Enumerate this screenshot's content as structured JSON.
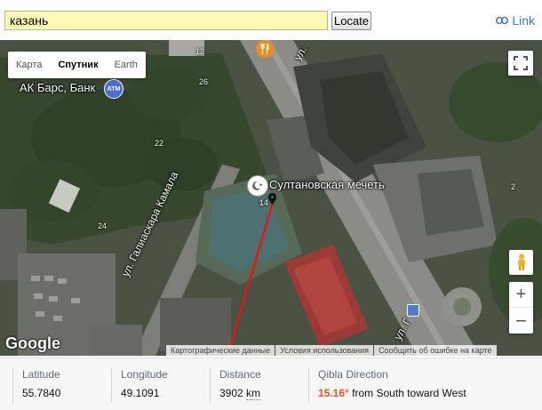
{
  "toolbar": {
    "search_value": "казань",
    "locate_label": "Locate",
    "link_label": "Link"
  },
  "map": {
    "map_type_buttons": [
      "Карта",
      "Спутник",
      "Earth"
    ],
    "active_map_type": "Спутник",
    "labels": {
      "poi_bank": "АК Барс, Банк",
      "poi_mosque": "Султановская мечеть",
      "street_galiaskara": "ул. Галиаскара Камала",
      "street_top": "ул.",
      "street_bottom": "ул. Г",
      "house_numbers": [
        "12",
        "26",
        "22",
        "24",
        "2",
        "14"
      ]
    },
    "logo": "Google",
    "attribution": [
      "Картографические данные",
      "Условия использования",
      "Сообщить об ошибке на карте"
    ],
    "qibla_line_color": "#e01818"
  },
  "info": {
    "latitude_label": "Latitude",
    "latitude_value": "55.7840",
    "longitude_label": "Longitude",
    "longitude_value": "49.1091",
    "distance_label": "Distance",
    "distance_value": "3902",
    "distance_unit": "km",
    "qibla_label": "Qibla Direction",
    "qibla_value": "15.16°",
    "qibla_suffix": "from South toward West"
  },
  "colors": {
    "accent_link": "#3a78c4",
    "qibla_value": "#e0551c",
    "search_bg": "#fafab4"
  }
}
